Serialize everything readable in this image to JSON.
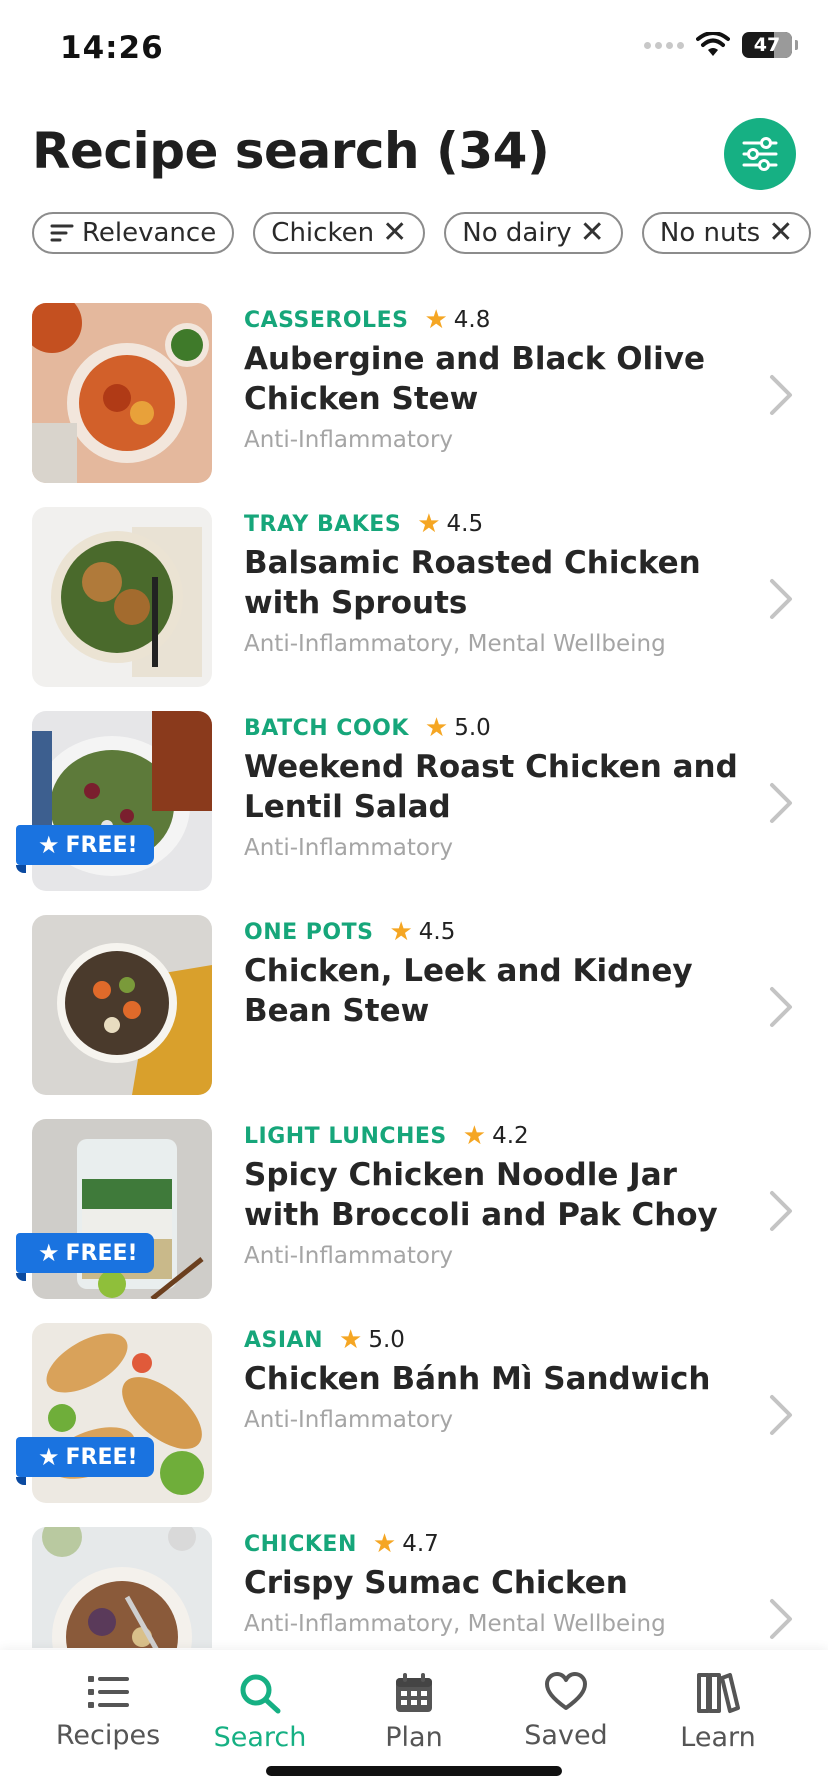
{
  "status_bar": {
    "time": "14:26",
    "battery": "47"
  },
  "header": {
    "title": "Recipe search (34)"
  },
  "chips": [
    {
      "label": "Relevance",
      "removable": false,
      "icon": "sort-icon"
    },
    {
      "label": "Chicken",
      "removable": true
    },
    {
      "label": "No dairy",
      "removable": true
    },
    {
      "label": "No nuts",
      "removable": true
    }
  ],
  "recipes": [
    {
      "category": "CASSEROLES",
      "rating": "4.8",
      "title": "Aubergine and Black Olive Chicken Stew",
      "tags": "Anti-Inflammatory",
      "free": false
    },
    {
      "category": "TRAY BAKES",
      "rating": "4.5",
      "title": "Balsamic Roasted Chicken with Sprouts",
      "tags": "Anti-Inflammatory, Mental Wellbeing",
      "free": false
    },
    {
      "category": "BATCH COOK",
      "rating": "5.0",
      "title": "Weekend Roast Chicken and Lentil Salad",
      "tags": "Anti-Inflammatory",
      "free": true
    },
    {
      "category": "ONE POTS",
      "rating": "4.5",
      "title": "Chicken, Leek and Kidney Bean Stew",
      "tags": "",
      "free": false
    },
    {
      "category": "LIGHT LUNCHES",
      "rating": "4.2",
      "title": "Spicy Chicken Noodle Jar with Broccoli and Pak Choy",
      "tags": "Anti-Inflammatory",
      "free": true
    },
    {
      "category": "ASIAN",
      "rating": "5.0",
      "title": "Chicken Bánh Mì Sandwich",
      "tags": "Anti-Inflammatory",
      "free": true
    },
    {
      "category": "CHICKEN",
      "rating": "4.7",
      "title": "Crispy Sumac Chicken",
      "tags": "Anti-Inflammatory, Mental Wellbeing",
      "free": false
    }
  ],
  "badge": {
    "free_label": "FREE!"
  },
  "tabs": [
    {
      "label": "Recipes",
      "icon": "list-icon",
      "active": false
    },
    {
      "label": "Search",
      "icon": "search-icon",
      "active": true
    },
    {
      "label": "Plan",
      "icon": "calendar-icon",
      "active": false
    },
    {
      "label": "Saved",
      "icon": "heart-icon",
      "active": false
    },
    {
      "label": "Learn",
      "icon": "books-icon",
      "active": false
    }
  ],
  "colors": {
    "accent": "#16b083",
    "category": "#16a67a",
    "star": "#f5a623",
    "badge": "#1a73e0",
    "tags": "#a5a5a5"
  }
}
